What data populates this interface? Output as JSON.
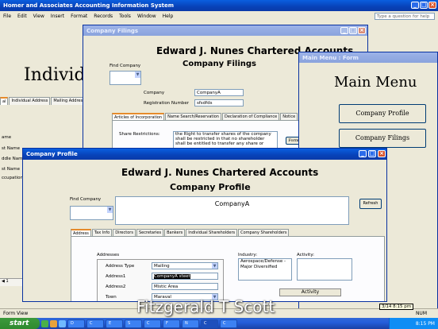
{
  "app": {
    "title": "Homer and Associates Accounting Information System",
    "help_placeholder": "Type a question for help"
  },
  "menu": [
    "File",
    "Edit",
    "View",
    "Insert",
    "Format",
    "Records",
    "Tools",
    "Window",
    "Help"
  ],
  "bg_window": {
    "title_partial": "Individ",
    "tabs": [
      "Individual Address",
      "Mailing Address"
    ],
    "labels": [
      "ame",
      "st Name",
      "ddle Name",
      "st Name",
      "ccupation"
    ],
    "record_nav": "1"
  },
  "filings": {
    "title": "Company Filings",
    "org": "Edward J. Nunes Chartered Accounts",
    "heading": "Company Filings",
    "find_label": "Find Company",
    "company_label": "Company",
    "company_value": "CompanyA",
    "reg_label": "Registration Number",
    "reg_value": "sfsdfds",
    "tabs": [
      "Articles of Incorporation",
      "Name Search/Reservation",
      "Declaration of Compliance",
      "Notice"
    ],
    "share_label": "Share Restrictions:",
    "share_text": "the Right to transfer shares of the company shall be restricted in that no shareholder shall be entitled to transfer any share or",
    "form_btn": "Form"
  },
  "main_menu": {
    "title": "Main Menu : Form",
    "heading": "Main Menu",
    "buttons": [
      "Company Profile",
      "Company Filings"
    ]
  },
  "profile": {
    "title": "Company Profile",
    "org": "Edward J. Nunes Chartered Accounts",
    "heading": "Company Profile",
    "find_label": "Find Company",
    "company_display": "CompanyA",
    "refresh": "Refresh",
    "tabs": [
      "Address",
      "Tax Info",
      "Directors",
      "Secretaries",
      "Bankers",
      "Individual Shareholders",
      "Company Shareholders"
    ],
    "addresses_label": "Addresses",
    "address_type_label": "Address Type",
    "address_type_value": "Mailing",
    "address1_label": "Address1",
    "address1_value": "CompanyA steet",
    "address2_label": "Address2",
    "address2_value": "Mistic Area",
    "town_label": "Town",
    "town_value": "Maraval",
    "industry_label": "Industry:",
    "industry_items": [
      "Aerospace/Defense -",
      "Major Diversified"
    ],
    "activity_label": "Activity:",
    "activity_header": "Activity"
  },
  "status": {
    "left": "Form View",
    "right": "NUM"
  },
  "watermark": "Fitzgerald T Scott",
  "tooltip": "3/14 8:15 pm",
  "taskbar": {
    "start": "start",
    "buttons": [
      "D",
      "C",
      "E",
      "S",
      "C",
      "F",
      "N",
      "C",
      "C"
    ],
    "clock": "8:15 PM"
  }
}
